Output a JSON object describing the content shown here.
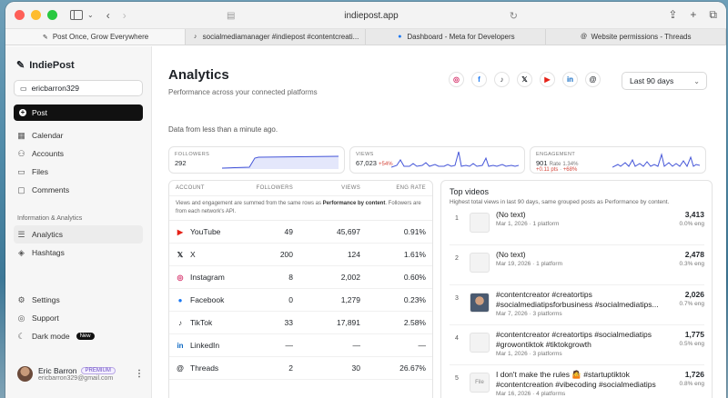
{
  "browser": {
    "url": "indiepost.app",
    "tabs": [
      {
        "label": "Post Once, Grow Everywhere",
        "icon": "feather-icon",
        "active": true
      },
      {
        "label": "socialmediamanager #indiepost #contentcreati...",
        "icon": "tiktok-icon",
        "active": false
      },
      {
        "label": "Dashboard - Meta for Developers",
        "icon": "facebook-icon",
        "active": false
      },
      {
        "label": "Website permissions - Threads",
        "icon": "threads-icon",
        "active": false
      }
    ]
  },
  "sidebar": {
    "brand": "IndiePost",
    "account": "ericbarron329",
    "post_label": "Post",
    "items": [
      {
        "label": "Calendar",
        "icon": "calendar-icon"
      },
      {
        "label": "Accounts",
        "icon": "accounts-icon"
      },
      {
        "label": "Files",
        "icon": "folder-icon"
      },
      {
        "label": "Comments",
        "icon": "comment-icon"
      }
    ],
    "section_label": "Information & Analytics",
    "info_items": [
      {
        "label": "Analytics",
        "icon": "database-icon"
      },
      {
        "label": "Hashtags",
        "icon": "layers-icon"
      }
    ],
    "bottom_items": [
      {
        "label": "Settings",
        "icon": "gear-icon"
      },
      {
        "label": "Support",
        "icon": "support-icon"
      },
      {
        "label": "Dark mode",
        "icon": "moon-icon",
        "badge": "New"
      }
    ],
    "user": {
      "name": "Eric Barron",
      "plan": "PREMIUM",
      "email": "ericbarron329@gmail.com"
    }
  },
  "header": {
    "title": "Analytics",
    "subtitle": "Performance across your connected platforms",
    "range": "Last 90 days",
    "networks": [
      "instagram",
      "facebook",
      "tiktok",
      "x",
      "youtube",
      "linkedin",
      "threads"
    ]
  },
  "freshness": "Data from less than a minute ago.",
  "stats": {
    "followers": {
      "label": "FOLLOWERS",
      "value": "292"
    },
    "views": {
      "label": "VIEWS",
      "value": "67,023",
      "delta": "+54%"
    },
    "engagement": {
      "label": "ENGAGEMENT",
      "value": "901",
      "rate_label": "Rate",
      "rate": "1.34%",
      "pts": "+0.11 pts",
      "delta": "+68%"
    }
  },
  "accounts_table": {
    "headers": {
      "account": "ACCOUNT",
      "followers": "FOLLOWERS",
      "views": "VIEWS",
      "eng_rate": "ENG RATE"
    },
    "note_pre": "Views and engagement are summed from the same rows as ",
    "note_bold": "Performance by content",
    "note_post": ". Followers are from each network's API.",
    "rows": [
      {
        "name": "YouTube",
        "icon": "youtube-icon",
        "followers": "49",
        "views": "45,697",
        "eng": "0.91%"
      },
      {
        "name": "X",
        "icon": "x-icon",
        "followers": "200",
        "views": "124",
        "eng": "1.61%"
      },
      {
        "name": "Instagram",
        "icon": "instagram-icon",
        "followers": "8",
        "views": "2,002",
        "eng": "0.60%"
      },
      {
        "name": "Facebook",
        "icon": "facebook-icon",
        "followers": "0",
        "views": "1,279",
        "eng": "0.23%"
      },
      {
        "name": "TikTok",
        "icon": "tiktok-icon",
        "followers": "33",
        "views": "17,891",
        "eng": "2.58%"
      },
      {
        "name": "LinkedIn",
        "icon": "linkedin-icon",
        "followers": "—",
        "views": "—",
        "eng": "—"
      },
      {
        "name": "Threads",
        "icon": "threads-icon",
        "followers": "2",
        "views": "30",
        "eng": "26.67%"
      }
    ]
  },
  "top_videos": {
    "title": "Top videos",
    "subtitle": "Highest total views in last 90 days, same grouped posts as Performance by content.",
    "items": [
      {
        "rank": "1",
        "text": "(No text)",
        "meta": "Mar 1, 2026 · 1 platform",
        "views": "3,413",
        "eng": "0.0% eng",
        "thumb": ""
      },
      {
        "rank": "2",
        "text": "(No text)",
        "meta": "Mar 19, 2026 · 1 platform",
        "views": "2,478",
        "eng": "0.3% eng",
        "thumb": ""
      },
      {
        "rank": "3",
        "text": "#contentcreator #creatortips #socialmediatipsforbusiness #socialmediatips...",
        "meta": "Mar 7, 2026 · 3 platforms",
        "views": "2,026",
        "eng": "0.7% eng",
        "thumb": "photo"
      },
      {
        "rank": "4",
        "text": "#contentcreator #creatortips #socialmediatips #growontiktok #tiktokgrowth",
        "meta": "Mar 1, 2026 · 3 platforms",
        "views": "1,775",
        "eng": "0.5% eng",
        "thumb": ""
      },
      {
        "rank": "5",
        "text": "I don't make the rules 🤷 #startuptiktok #contentcreation #vibecoding #socialmediatips",
        "meta": "Mar 16, 2026 · 4 platforms",
        "views": "1,726",
        "eng": "0.8% eng",
        "thumb": "File"
      }
    ]
  },
  "colors": {
    "accent": "#4455d8",
    "spark_fill": "#e4e7fb",
    "negative": "#d4463b"
  }
}
